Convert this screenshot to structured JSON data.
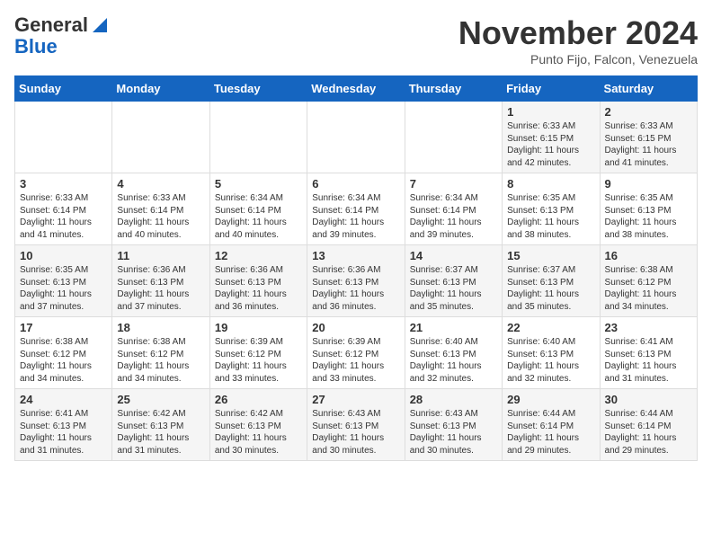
{
  "header": {
    "logo_general": "General",
    "logo_blue": "Blue",
    "month_title": "November 2024",
    "location": "Punto Fijo, Falcon, Venezuela"
  },
  "weekdays": [
    "Sunday",
    "Monday",
    "Tuesday",
    "Wednesday",
    "Thursday",
    "Friday",
    "Saturday"
  ],
  "weeks": [
    [
      {
        "day": "",
        "info": ""
      },
      {
        "day": "",
        "info": ""
      },
      {
        "day": "",
        "info": ""
      },
      {
        "day": "",
        "info": ""
      },
      {
        "day": "",
        "info": ""
      },
      {
        "day": "1",
        "info": "Sunrise: 6:33 AM\nSunset: 6:15 PM\nDaylight: 11 hours and 42 minutes."
      },
      {
        "day": "2",
        "info": "Sunrise: 6:33 AM\nSunset: 6:15 PM\nDaylight: 11 hours and 41 minutes."
      }
    ],
    [
      {
        "day": "3",
        "info": "Sunrise: 6:33 AM\nSunset: 6:14 PM\nDaylight: 11 hours and 41 minutes."
      },
      {
        "day": "4",
        "info": "Sunrise: 6:33 AM\nSunset: 6:14 PM\nDaylight: 11 hours and 40 minutes."
      },
      {
        "day": "5",
        "info": "Sunrise: 6:34 AM\nSunset: 6:14 PM\nDaylight: 11 hours and 40 minutes."
      },
      {
        "day": "6",
        "info": "Sunrise: 6:34 AM\nSunset: 6:14 PM\nDaylight: 11 hours and 39 minutes."
      },
      {
        "day": "7",
        "info": "Sunrise: 6:34 AM\nSunset: 6:14 PM\nDaylight: 11 hours and 39 minutes."
      },
      {
        "day": "8",
        "info": "Sunrise: 6:35 AM\nSunset: 6:13 PM\nDaylight: 11 hours and 38 minutes."
      },
      {
        "day": "9",
        "info": "Sunrise: 6:35 AM\nSunset: 6:13 PM\nDaylight: 11 hours and 38 minutes."
      }
    ],
    [
      {
        "day": "10",
        "info": "Sunrise: 6:35 AM\nSunset: 6:13 PM\nDaylight: 11 hours and 37 minutes."
      },
      {
        "day": "11",
        "info": "Sunrise: 6:36 AM\nSunset: 6:13 PM\nDaylight: 11 hours and 37 minutes."
      },
      {
        "day": "12",
        "info": "Sunrise: 6:36 AM\nSunset: 6:13 PM\nDaylight: 11 hours and 36 minutes."
      },
      {
        "day": "13",
        "info": "Sunrise: 6:36 AM\nSunset: 6:13 PM\nDaylight: 11 hours and 36 minutes."
      },
      {
        "day": "14",
        "info": "Sunrise: 6:37 AM\nSunset: 6:13 PM\nDaylight: 11 hours and 35 minutes."
      },
      {
        "day": "15",
        "info": "Sunrise: 6:37 AM\nSunset: 6:13 PM\nDaylight: 11 hours and 35 minutes."
      },
      {
        "day": "16",
        "info": "Sunrise: 6:38 AM\nSunset: 6:12 PM\nDaylight: 11 hours and 34 minutes."
      }
    ],
    [
      {
        "day": "17",
        "info": "Sunrise: 6:38 AM\nSunset: 6:12 PM\nDaylight: 11 hours and 34 minutes."
      },
      {
        "day": "18",
        "info": "Sunrise: 6:38 AM\nSunset: 6:12 PM\nDaylight: 11 hours and 34 minutes."
      },
      {
        "day": "19",
        "info": "Sunrise: 6:39 AM\nSunset: 6:12 PM\nDaylight: 11 hours and 33 minutes."
      },
      {
        "day": "20",
        "info": "Sunrise: 6:39 AM\nSunset: 6:12 PM\nDaylight: 11 hours and 33 minutes."
      },
      {
        "day": "21",
        "info": "Sunrise: 6:40 AM\nSunset: 6:13 PM\nDaylight: 11 hours and 32 minutes."
      },
      {
        "day": "22",
        "info": "Sunrise: 6:40 AM\nSunset: 6:13 PM\nDaylight: 11 hours and 32 minutes."
      },
      {
        "day": "23",
        "info": "Sunrise: 6:41 AM\nSunset: 6:13 PM\nDaylight: 11 hours and 31 minutes."
      }
    ],
    [
      {
        "day": "24",
        "info": "Sunrise: 6:41 AM\nSunset: 6:13 PM\nDaylight: 11 hours and 31 minutes."
      },
      {
        "day": "25",
        "info": "Sunrise: 6:42 AM\nSunset: 6:13 PM\nDaylight: 11 hours and 31 minutes."
      },
      {
        "day": "26",
        "info": "Sunrise: 6:42 AM\nSunset: 6:13 PM\nDaylight: 11 hours and 30 minutes."
      },
      {
        "day": "27",
        "info": "Sunrise: 6:43 AM\nSunset: 6:13 PM\nDaylight: 11 hours and 30 minutes."
      },
      {
        "day": "28",
        "info": "Sunrise: 6:43 AM\nSunset: 6:13 PM\nDaylight: 11 hours and 30 minutes."
      },
      {
        "day": "29",
        "info": "Sunrise: 6:44 AM\nSunset: 6:14 PM\nDaylight: 11 hours and 29 minutes."
      },
      {
        "day": "30",
        "info": "Sunrise: 6:44 AM\nSunset: 6:14 PM\nDaylight: 11 hours and 29 minutes."
      }
    ]
  ]
}
